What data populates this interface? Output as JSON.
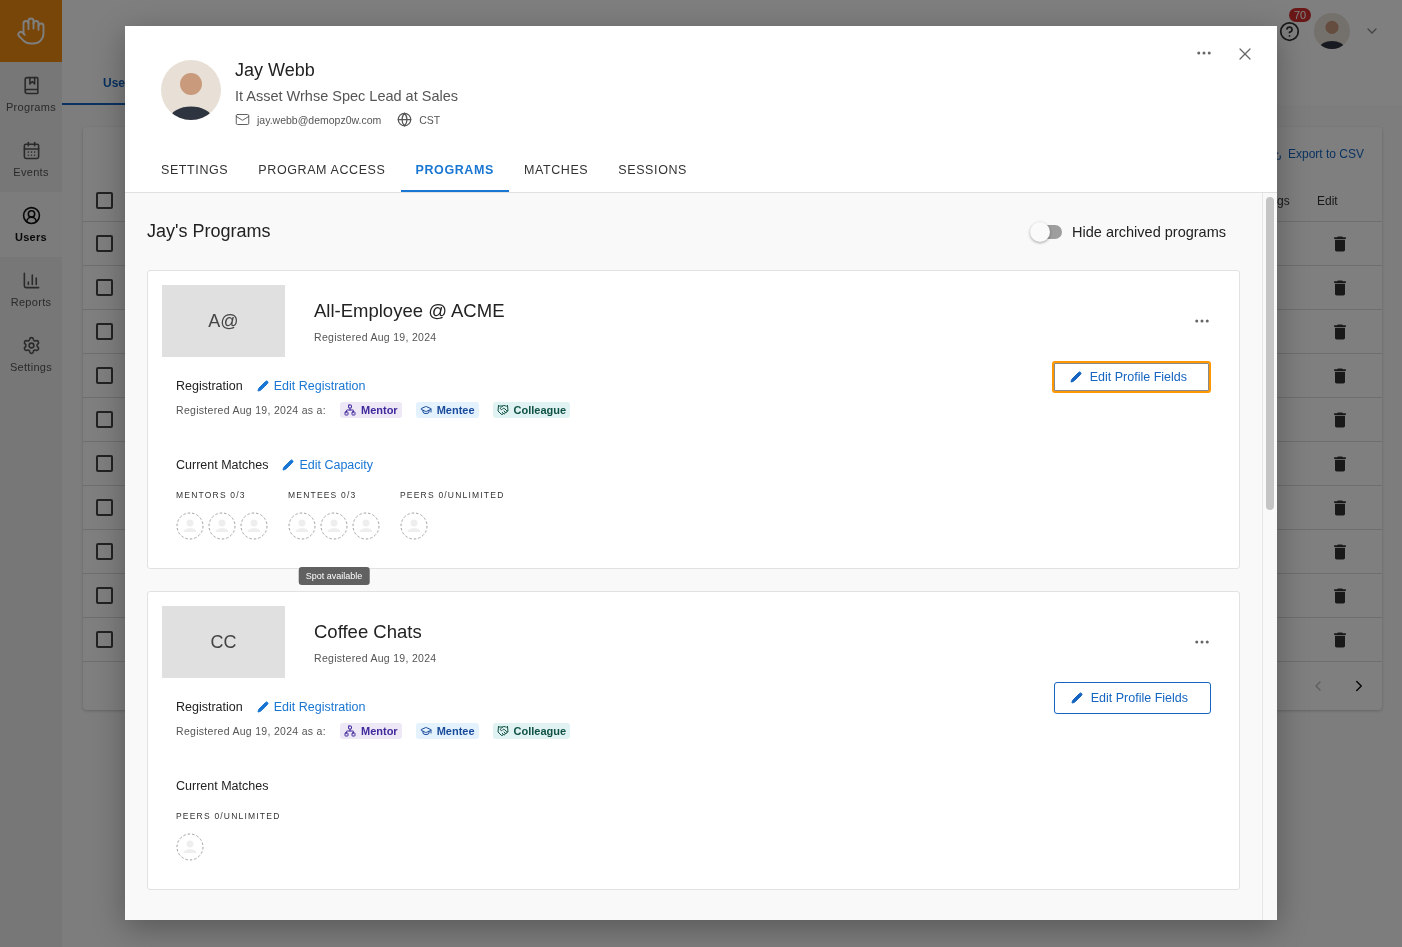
{
  "app": {
    "nav": [
      {
        "label": "Programs",
        "selected": false
      },
      {
        "label": "Events",
        "selected": false
      },
      {
        "label": "Users",
        "selected": true
      },
      {
        "label": "Reports",
        "selected": false
      },
      {
        "label": "Settings",
        "selected": false
      }
    ],
    "notification_count": "70",
    "page_tab": "Use",
    "export_label": "Export to CSV",
    "columns": [
      "gs",
      "Edit"
    ],
    "header_checkbox": {
      "checked": false
    },
    "rows": [
      {
        "checked": false
      },
      {
        "checked": false
      },
      {
        "checked": false
      },
      {
        "checked": false
      },
      {
        "checked": false
      },
      {
        "checked": false
      },
      {
        "checked": false
      },
      {
        "checked": false
      },
      {
        "checked": false
      },
      {
        "checked": false
      }
    ]
  },
  "modal": {
    "user": {
      "name": "Jay Webb",
      "title": "It Asset Wrhse Spec Lead at Sales",
      "email": "jay.webb@demopz0w.com",
      "timezone": "CST"
    },
    "tabs": [
      {
        "label": "SETTINGS",
        "selected": false
      },
      {
        "label": "PROGRAM ACCESS",
        "selected": false
      },
      {
        "label": "PROGRAMS",
        "selected": true
      },
      {
        "label": "MATCHES",
        "selected": false
      },
      {
        "label": "SESSIONS",
        "selected": false
      }
    ],
    "section_title": "Jay's Programs",
    "archive_toggle": {
      "label": "Hide archived programs",
      "on": false
    },
    "programs": [
      {
        "initials": "A@",
        "name": "All-Employee @ ACME",
        "registered": "Registered Aug 19, 2024",
        "registration_label": "Registration",
        "edit_registration": "Edit Registration",
        "registered_as": "Registered Aug 19, 2024 as a:",
        "roles": [
          {
            "label": "Mentor",
            "kind": "mentor"
          },
          {
            "label": "Mentee",
            "kind": "mentee"
          },
          {
            "label": "Colleague",
            "kind": "colleague"
          }
        ],
        "edit_profile": {
          "label": "Edit Profile Fields",
          "focused": true
        },
        "matches_label": "Current Matches",
        "edit_capacity": "Edit Capacity",
        "groups": [
          {
            "label": "MENTORS 0/3",
            "slots": [
              {
                "filled": false
              },
              {
                "filled": false
              },
              {
                "filled": false
              }
            ]
          },
          {
            "label": "MENTEES 0/3",
            "slots": [
              {
                "filled": false
              },
              {
                "filled": false
              },
              {
                "filled": false
              }
            ],
            "tooltip": "Spot available"
          },
          {
            "label": "PEERS 0/UNLIMITED",
            "slots": [
              {
                "filled": false
              }
            ]
          }
        ]
      },
      {
        "initials": "CC",
        "name": "Coffee Chats",
        "registered": "Registered Aug 19, 2024",
        "registration_label": "Registration",
        "edit_registration": "Edit Registration",
        "registered_as": "Registered Aug 19, 2024 as a:",
        "roles": [
          {
            "label": "Mentor",
            "kind": "mentor"
          },
          {
            "label": "Mentee",
            "kind": "mentee"
          },
          {
            "label": "Colleague",
            "kind": "colleague"
          }
        ],
        "edit_profile": {
          "label": "Edit Profile Fields",
          "focused": false
        },
        "matches_label": "Current Matches",
        "groups": [
          {
            "label": "PEERS 0/UNLIMITED",
            "slots": [
              {
                "filled": false
              }
            ]
          }
        ]
      }
    ]
  }
}
